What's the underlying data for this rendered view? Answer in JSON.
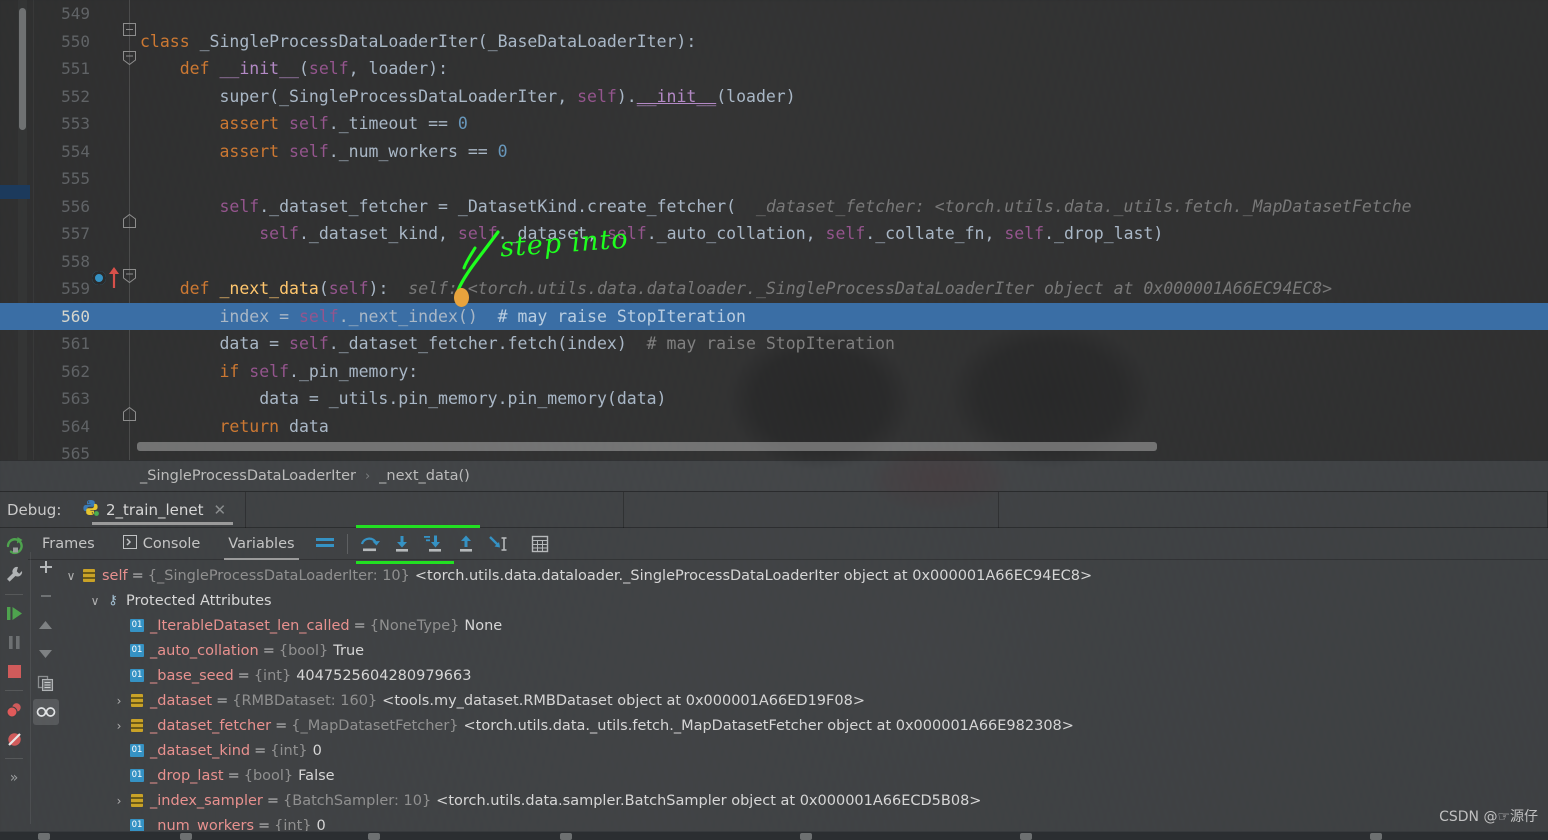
{
  "editor": {
    "lines": [
      {
        "num": "549",
        "tokens": []
      },
      {
        "num": "550",
        "tokens": [
          {
            "t": "class ",
            "c": "kw"
          },
          {
            "t": "_SingleProcessDataLoaderIter(_BaseDataLoaderIter):",
            "c": "pl"
          }
        ]
      },
      {
        "num": "551",
        "tokens": [
          {
            "t": "    ",
            "c": "pl"
          },
          {
            "t": "def ",
            "c": "kw"
          },
          {
            "t": "__init__",
            "c": "mg"
          },
          {
            "t": "(",
            "c": "pl"
          },
          {
            "t": "self",
            "c": "sf"
          },
          {
            "t": ", loader):",
            "c": "pl"
          }
        ]
      },
      {
        "num": "552",
        "tokens": [
          {
            "t": "        super(_SingleProcessDataLoaderIter, ",
            "c": "pl"
          },
          {
            "t": "self",
            "c": "sf"
          },
          {
            "t": ").",
            "c": "pl"
          },
          {
            "t": "__init__",
            "c": "dun"
          },
          {
            "t": "(loader)",
            "c": "pl"
          }
        ]
      },
      {
        "num": "553",
        "tokens": [
          {
            "t": "        ",
            "c": "pl"
          },
          {
            "t": "assert ",
            "c": "kw"
          },
          {
            "t": "self",
            "c": "sf"
          },
          {
            "t": "._timeout == ",
            "c": "pl"
          },
          {
            "t": "0",
            "c": "num"
          }
        ]
      },
      {
        "num": "554",
        "tokens": [
          {
            "t": "        ",
            "c": "pl"
          },
          {
            "t": "assert ",
            "c": "kw"
          },
          {
            "t": "self",
            "c": "sf"
          },
          {
            "t": "._num_workers == ",
            "c": "pl"
          },
          {
            "t": "0",
            "c": "num"
          }
        ]
      },
      {
        "num": "555",
        "tokens": []
      },
      {
        "num": "556",
        "tokens": [
          {
            "t": "        ",
            "c": "pl"
          },
          {
            "t": "self",
            "c": "sf"
          },
          {
            "t": "._dataset_fetcher = _DatasetKind.create_fetcher(",
            "c": "pl"
          },
          {
            "t": "  _dataset_fetcher: <torch.utils.data._utils.fetch._MapDatasetFetche",
            "c": "hint"
          }
        ]
      },
      {
        "num": "557",
        "tokens": [
          {
            "t": "            ",
            "c": "pl"
          },
          {
            "t": "self",
            "c": "sf"
          },
          {
            "t": "._dataset_kind, ",
            "c": "pl"
          },
          {
            "t": "self",
            "c": "sf"
          },
          {
            "t": "._dataset, ",
            "c": "pl"
          },
          {
            "t": "self",
            "c": "sf"
          },
          {
            "t": "._auto_collation, ",
            "c": "pl"
          },
          {
            "t": "self",
            "c": "sf"
          },
          {
            "t": "._collate_fn, ",
            "c": "pl"
          },
          {
            "t": "self",
            "c": "sf"
          },
          {
            "t": "._drop_last)",
            "c": "pl"
          }
        ]
      },
      {
        "num": "558",
        "tokens": []
      },
      {
        "num": "559",
        "tokens": [
          {
            "t": "    ",
            "c": "pl"
          },
          {
            "t": "def ",
            "c": "kw"
          },
          {
            "t": "_next_data",
            "c": "fn"
          },
          {
            "t": "(",
            "c": "pl"
          },
          {
            "t": "self",
            "c": "sf"
          },
          {
            "t": "):",
            "c": "pl"
          },
          {
            "t": "  self: <torch.utils.data.dataloader._SingleProcessDataLoaderIter object at 0x000001A66EC94EC8>",
            "c": "hint"
          }
        ]
      },
      {
        "num": "560",
        "selected": true,
        "tokens": [
          {
            "t": "        index = ",
            "c": "pl"
          },
          {
            "t": "self",
            "c": "sf"
          },
          {
            "t": "._next_index()",
            "c": "pl"
          },
          {
            "t": "  # may raise StopIteration",
            "c": "cm"
          }
        ]
      },
      {
        "num": "561",
        "tokens": [
          {
            "t": "        data = ",
            "c": "pl"
          },
          {
            "t": "self",
            "c": "sf"
          },
          {
            "t": "._dataset_fetcher.fetch(index)",
            "c": "pl"
          },
          {
            "t": "  # may raise StopIteration",
            "c": "cm"
          }
        ]
      },
      {
        "num": "562",
        "tokens": [
          {
            "t": "        ",
            "c": "pl"
          },
          {
            "t": "if ",
            "c": "kw"
          },
          {
            "t": "self",
            "c": "sf"
          },
          {
            "t": "._pin_memory:",
            "c": "pl"
          }
        ]
      },
      {
        "num": "563",
        "tokens": [
          {
            "t": "            data = _utils.pin_memory.pin_memory(data)",
            "c": "pl"
          }
        ]
      },
      {
        "num": "564",
        "tokens": [
          {
            "t": "        ",
            "c": "pl"
          },
          {
            "t": "return ",
            "c": "kw"
          },
          {
            "t": "data",
            "c": "pl"
          }
        ]
      },
      {
        "num": "565",
        "tokens": []
      }
    ],
    "annotation": {
      "text": "step into",
      "color": "#1eff1e",
      "marker_color": "#e8a33d"
    },
    "breakpoint_line": "559",
    "current_line": "560",
    "selection_color": "#3a6ea5"
  },
  "breadcrumb": {
    "items": [
      "_SingleProcessDataLoaderIter",
      "_next_data()"
    ],
    "separator": "›"
  },
  "debug": {
    "label": "Debug:",
    "run_config": "2_train_lenet",
    "close_label": "✕",
    "python_icon": "python-icon",
    "tabs": [
      {
        "label": "Frames",
        "icon": "",
        "active": false
      },
      {
        "label": "Console",
        "icon": "console-icon",
        "active": false
      },
      {
        "label": "Variables",
        "icon": "",
        "active": true
      }
    ],
    "left_rail": [
      {
        "name": "rerun-button",
        "icon": "rerun-icon",
        "color": "#4ea34e"
      },
      {
        "name": "debugger-settings-button",
        "icon": "wrench-icon",
        "color": "#b0b3b5"
      },
      {
        "name": "resume-program-button",
        "icon": "resume-icon",
        "color": "#4ea34e"
      },
      {
        "name": "pause-program-button",
        "icon": "pause-icon",
        "color": "#6d7072"
      },
      {
        "name": "stop-button",
        "icon": "stop-icon",
        "color": "#d05b5b"
      },
      {
        "name": "view-breakpoints-button",
        "icon": "breakpoints-icon",
        "color": "#d05b5b"
      },
      {
        "name": "mute-breakpoints-button",
        "icon": "mute-breakpoints-icon",
        "color": "#d05b5b"
      },
      {
        "name": "more-options-button",
        "icon": "chevron-double-right-icon",
        "color": "#9a9d9e"
      }
    ],
    "var_rail": [
      {
        "name": "add-watch-button",
        "icon": "plus-icon",
        "glyph": "＋",
        "active": false
      },
      {
        "name": "remove-watch-button",
        "icon": "minus-icon",
        "glyph": "–",
        "active": false
      },
      {
        "name": "move-up-button",
        "icon": "arrow-up-icon",
        "glyph": "▲",
        "active": false
      },
      {
        "name": "move-down-button",
        "icon": "arrow-down-icon",
        "glyph": "▼",
        "active": false
      },
      {
        "name": "copy-value-button",
        "icon": "copy-icon",
        "glyph": "❐",
        "active": false
      },
      {
        "name": "inspect-button",
        "icon": "glasses-icon",
        "glyph": "○○",
        "active": true
      }
    ],
    "step_buttons": [
      {
        "name": "step-over-button",
        "icon": "step-over-icon"
      },
      {
        "name": "step-into-button",
        "icon": "step-into-icon"
      },
      {
        "name": "force-step-into-button",
        "icon": "force-step-into-icon"
      },
      {
        "name": "step-out-button",
        "icon": "step-out-icon"
      },
      {
        "name": "run-to-cursor-button",
        "icon": "run-to-cursor-icon"
      },
      {
        "name": "evaluate-expression-button",
        "icon": "calculator-icon"
      }
    ],
    "accent_green": "#22e022",
    "icon_blue": "#3592c4"
  },
  "variables": [
    {
      "indent": 0,
      "twisty": "∨",
      "icon": "object",
      "name": "self",
      "eq": "=",
      "type": "{_SingleProcessDataLoaderIter: 10}",
      "value": "<torch.utils.data.dataloader._SingleProcessDataLoaderIter object at 0x000001A66EC94EC8>"
    },
    {
      "indent": 1,
      "twisty": "∨",
      "icon": "group",
      "name": "Protected Attributes",
      "eq": "",
      "type": "",
      "value": ""
    },
    {
      "indent": 2,
      "twisty": "",
      "icon": "field",
      "name": "_IterableDataset_len_called",
      "eq": "=",
      "type": "{NoneType}",
      "value": "None"
    },
    {
      "indent": 2,
      "twisty": "",
      "icon": "field",
      "name": "_auto_collation",
      "eq": "=",
      "type": "{bool}",
      "value": "True"
    },
    {
      "indent": 2,
      "twisty": "",
      "icon": "field",
      "name": "_base_seed",
      "eq": "=",
      "type": "{int}",
      "value": "4047525604280979663"
    },
    {
      "indent": 2,
      "twisty": "›",
      "icon": "object",
      "name": "_dataset",
      "eq": "=",
      "type": "{RMBDataset: 160}",
      "value": "<tools.my_dataset.RMBDataset object at 0x000001A66ED19F08>"
    },
    {
      "indent": 2,
      "twisty": "›",
      "icon": "object",
      "name": "_dataset_fetcher",
      "eq": "=",
      "type": "{_MapDatasetFetcher}",
      "value": "<torch.utils.data._utils.fetch._MapDatasetFetcher object at 0x000001A66E982308>"
    },
    {
      "indent": 2,
      "twisty": "",
      "icon": "field",
      "name": "_dataset_kind",
      "eq": "=",
      "type": "{int}",
      "value": "0"
    },
    {
      "indent": 2,
      "twisty": "",
      "icon": "field",
      "name": "_drop_last",
      "eq": "=",
      "type": "{bool}",
      "value": "False"
    },
    {
      "indent": 2,
      "twisty": "›",
      "icon": "object",
      "name": "_index_sampler",
      "eq": "=",
      "type": "{BatchSampler: 10}",
      "value": "<torch.utils.data.sampler.BatchSampler object at 0x000001A66ECD5B08>"
    },
    {
      "indent": 2,
      "twisty": "",
      "icon": "field",
      "name": "_num_workers",
      "eq": "=",
      "type": "{int}",
      "value": "0"
    }
  ],
  "watermark": "CSDN @☞源仔"
}
